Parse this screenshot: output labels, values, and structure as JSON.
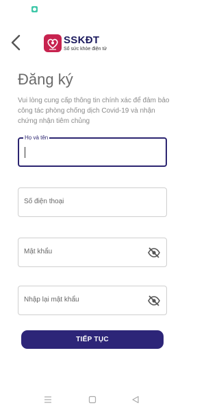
{
  "app": {
    "brand_title": "SSKĐT",
    "brand_subtitle": "Sổ sức khỏe điện tử"
  },
  "page": {
    "title": "Đăng ký",
    "subtitle": "Vui lòng cung cấp thông tin chính xác để đảm bảo công tác phòng chống dịch Covid-19 và nhận chứng nhận tiêm chủng"
  },
  "form": {
    "full_name": {
      "label": "Họ và tên",
      "value": ""
    },
    "phone": {
      "placeholder": "Số điện thoại",
      "value": ""
    },
    "password": {
      "placeholder": "Mật khẩu",
      "value": ""
    },
    "confirm_password": {
      "placeholder": "Nhập lại mật khẩu",
      "value": ""
    },
    "submit_label": "TIẾP TỤC"
  },
  "icons": {
    "back": "chevron-left-icon",
    "logo": "heart-shield-logo",
    "password_toggle": "eye-off-icon",
    "nav_menu": "menu-icon",
    "nav_home": "square-home-icon",
    "nav_back": "triangle-back-icon"
  },
  "colors": {
    "primary": "#2d2578",
    "logo": "#c7234f",
    "status_accent": "#3ec7a8"
  }
}
